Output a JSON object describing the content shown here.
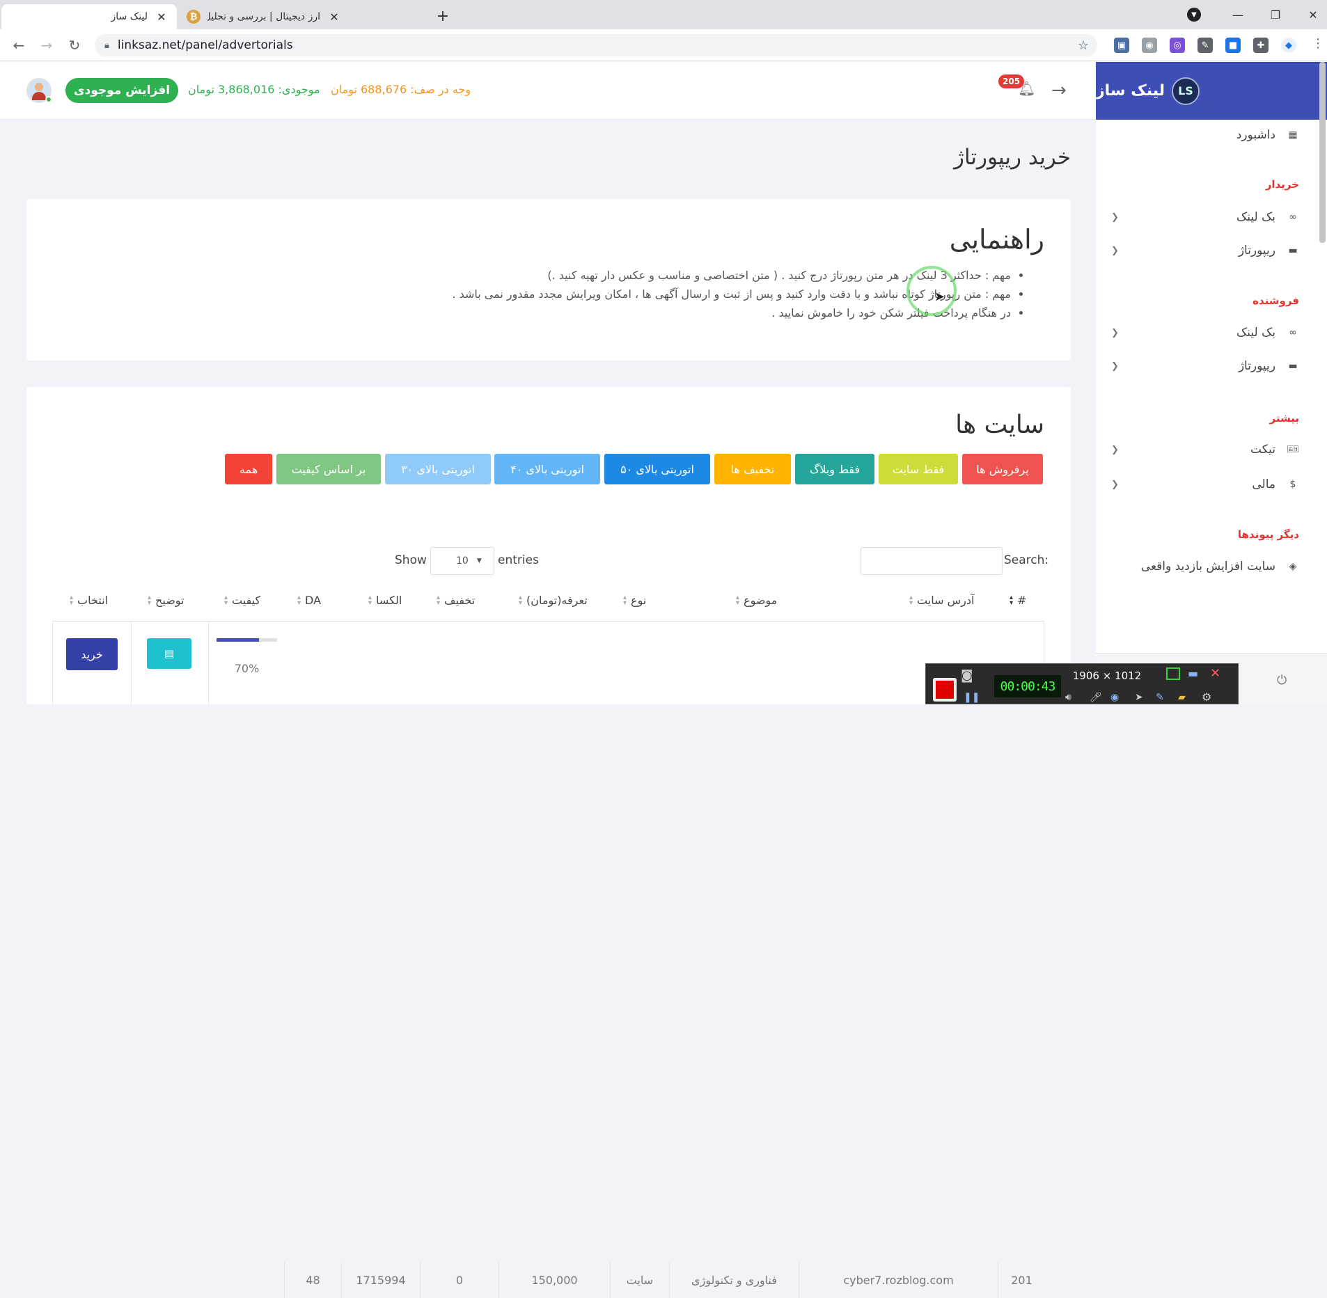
{
  "browser": {
    "tabs": [
      {
        "title": "لینک ساز",
        "favicon": "L"
      },
      {
        "title": "ارز دیجیتال | بررسی و تحلیل و اخبار",
        "favicon": "₿"
      }
    ],
    "url": "linksaz.net/panel/advertorials"
  },
  "brand": {
    "name": "لینک ساز"
  },
  "topbar": {
    "notifications_count": "205",
    "queue_label": "وجه در صف:",
    "queue_value": "688,676 تومان",
    "balance_label": "موجودی:",
    "balance_value": "3,868,016 تومان",
    "increase_label": "افزایش موجودی"
  },
  "sidebar": {
    "dashboard": "داشبورد",
    "buyer_head": "خریدار",
    "buyer_items": [
      "بک لینک",
      "ریپورتاژ"
    ],
    "seller_head": "فروشنده",
    "seller_items": [
      "بک لینک",
      "ریپورتاژ"
    ],
    "more_head": "بیشتر",
    "more_items": [
      "تیکت",
      "مالی"
    ],
    "links_head": "دیگر پیوندها",
    "links_items": [
      "سایت افزایش بازدید واقعی"
    ]
  },
  "page": {
    "title": "خرید ریپورتاژ"
  },
  "guide": {
    "title": "راهنمایی",
    "items": [
      "مهم : حداکثر 3 لینک در هر متن رپورتاژ درج کنید . ( متن اختصاصی و مناسب و عکس دار تهیه کنید .)",
      "مهم : متن رپورتاژ کوتاه نباشد و با دقت وارد کنید و پس از ثبت و ارسال آگهی ها ، امکان ویرایش مجدد مقدور نمی باشد .",
      "در هنگام پرداخت فیلتر شکن خود را خاموش نمایید ."
    ]
  },
  "sites": {
    "title": "سایت ها",
    "filters": [
      {
        "label": "پرفروش ها",
        "color": "#ef5350"
      },
      {
        "label": "فقط سایت",
        "color": "#cddc39"
      },
      {
        "label": "فقط وبلاگ",
        "color": "#26a69a"
      },
      {
        "label": "تخفیف ها",
        "color": "#ffb300"
      },
      {
        "label": "اتوریتی بالای ۵۰",
        "color": "#1e88e5"
      },
      {
        "label": "اتوریتی بالای ۴۰",
        "color": "#64b5f6"
      },
      {
        "label": "اتوریتی بالای ۳۰",
        "color": "#90caf9"
      },
      {
        "label": "بر اساس کیفیت",
        "color": "#81c784"
      },
      {
        "label": "همه",
        "color": "#f44336"
      }
    ],
    "search_label": "Search:",
    "show_label": "Show",
    "entries_label": "entries",
    "page_size": "10",
    "columns": [
      "#",
      "آدرس سایت",
      "موضوع",
      "نوع",
      "تعرفه(تومان)",
      "تخفیف",
      "الکسا",
      "DA",
      "کیفیت",
      "توضیح",
      "انتخاب"
    ],
    "rows": [
      {
        "id": "201",
        "address": "cyber7.rozblog.com",
        "topic": "فناوری و تکنولوژی",
        "type": "سایت",
        "price": "150,000",
        "discount": "0",
        "alexa": "1715994",
        "da": "48",
        "quality": "70%",
        "quality_fraction": 0.7,
        "buy_label": "خرید"
      }
    ]
  },
  "recorder": {
    "resolution": "1906 × 1012",
    "timer": "00:00:43"
  }
}
